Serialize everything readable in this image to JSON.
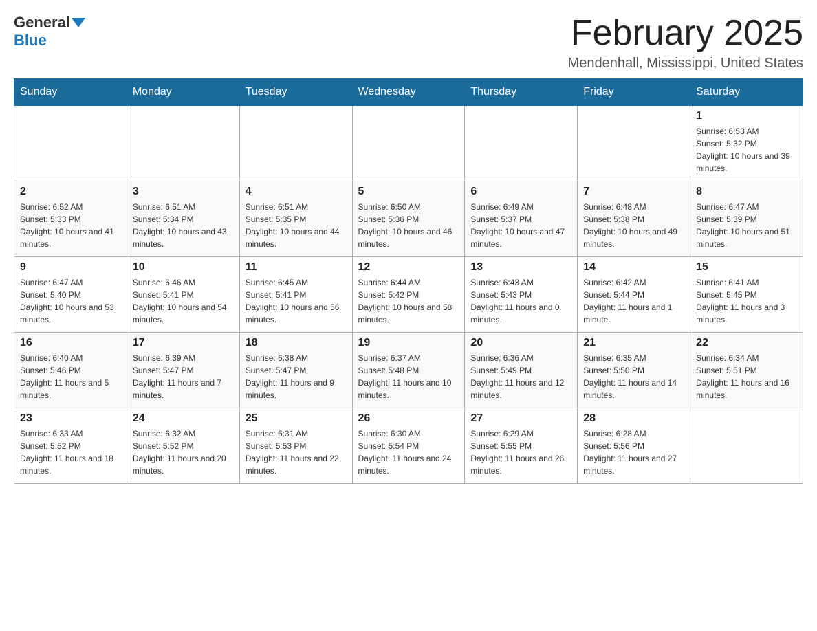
{
  "logo": {
    "general": "General",
    "blue": "Blue"
  },
  "title": "February 2025",
  "location": "Mendenhall, Mississippi, United States",
  "weekdays": [
    "Sunday",
    "Monday",
    "Tuesday",
    "Wednesday",
    "Thursday",
    "Friday",
    "Saturday"
  ],
  "weeks": [
    [
      {
        "day": "",
        "sunrise": "",
        "sunset": "",
        "daylight": ""
      },
      {
        "day": "",
        "sunrise": "",
        "sunset": "",
        "daylight": ""
      },
      {
        "day": "",
        "sunrise": "",
        "sunset": "",
        "daylight": ""
      },
      {
        "day": "",
        "sunrise": "",
        "sunset": "",
        "daylight": ""
      },
      {
        "day": "",
        "sunrise": "",
        "sunset": "",
        "daylight": ""
      },
      {
        "day": "",
        "sunrise": "",
        "sunset": "",
        "daylight": ""
      },
      {
        "day": "1",
        "sunrise": "Sunrise: 6:53 AM",
        "sunset": "Sunset: 5:32 PM",
        "daylight": "Daylight: 10 hours and 39 minutes."
      }
    ],
    [
      {
        "day": "2",
        "sunrise": "Sunrise: 6:52 AM",
        "sunset": "Sunset: 5:33 PM",
        "daylight": "Daylight: 10 hours and 41 minutes."
      },
      {
        "day": "3",
        "sunrise": "Sunrise: 6:51 AM",
        "sunset": "Sunset: 5:34 PM",
        "daylight": "Daylight: 10 hours and 43 minutes."
      },
      {
        "day": "4",
        "sunrise": "Sunrise: 6:51 AM",
        "sunset": "Sunset: 5:35 PM",
        "daylight": "Daylight: 10 hours and 44 minutes."
      },
      {
        "day": "5",
        "sunrise": "Sunrise: 6:50 AM",
        "sunset": "Sunset: 5:36 PM",
        "daylight": "Daylight: 10 hours and 46 minutes."
      },
      {
        "day": "6",
        "sunrise": "Sunrise: 6:49 AM",
        "sunset": "Sunset: 5:37 PM",
        "daylight": "Daylight: 10 hours and 47 minutes."
      },
      {
        "day": "7",
        "sunrise": "Sunrise: 6:48 AM",
        "sunset": "Sunset: 5:38 PM",
        "daylight": "Daylight: 10 hours and 49 minutes."
      },
      {
        "day": "8",
        "sunrise": "Sunrise: 6:47 AM",
        "sunset": "Sunset: 5:39 PM",
        "daylight": "Daylight: 10 hours and 51 minutes."
      }
    ],
    [
      {
        "day": "9",
        "sunrise": "Sunrise: 6:47 AM",
        "sunset": "Sunset: 5:40 PM",
        "daylight": "Daylight: 10 hours and 53 minutes."
      },
      {
        "day": "10",
        "sunrise": "Sunrise: 6:46 AM",
        "sunset": "Sunset: 5:41 PM",
        "daylight": "Daylight: 10 hours and 54 minutes."
      },
      {
        "day": "11",
        "sunrise": "Sunrise: 6:45 AM",
        "sunset": "Sunset: 5:41 PM",
        "daylight": "Daylight: 10 hours and 56 minutes."
      },
      {
        "day": "12",
        "sunrise": "Sunrise: 6:44 AM",
        "sunset": "Sunset: 5:42 PM",
        "daylight": "Daylight: 10 hours and 58 minutes."
      },
      {
        "day": "13",
        "sunrise": "Sunrise: 6:43 AM",
        "sunset": "Sunset: 5:43 PM",
        "daylight": "Daylight: 11 hours and 0 minutes."
      },
      {
        "day": "14",
        "sunrise": "Sunrise: 6:42 AM",
        "sunset": "Sunset: 5:44 PM",
        "daylight": "Daylight: 11 hours and 1 minute."
      },
      {
        "day": "15",
        "sunrise": "Sunrise: 6:41 AM",
        "sunset": "Sunset: 5:45 PM",
        "daylight": "Daylight: 11 hours and 3 minutes."
      }
    ],
    [
      {
        "day": "16",
        "sunrise": "Sunrise: 6:40 AM",
        "sunset": "Sunset: 5:46 PM",
        "daylight": "Daylight: 11 hours and 5 minutes."
      },
      {
        "day": "17",
        "sunrise": "Sunrise: 6:39 AM",
        "sunset": "Sunset: 5:47 PM",
        "daylight": "Daylight: 11 hours and 7 minutes."
      },
      {
        "day": "18",
        "sunrise": "Sunrise: 6:38 AM",
        "sunset": "Sunset: 5:47 PM",
        "daylight": "Daylight: 11 hours and 9 minutes."
      },
      {
        "day": "19",
        "sunrise": "Sunrise: 6:37 AM",
        "sunset": "Sunset: 5:48 PM",
        "daylight": "Daylight: 11 hours and 10 minutes."
      },
      {
        "day": "20",
        "sunrise": "Sunrise: 6:36 AM",
        "sunset": "Sunset: 5:49 PM",
        "daylight": "Daylight: 11 hours and 12 minutes."
      },
      {
        "day": "21",
        "sunrise": "Sunrise: 6:35 AM",
        "sunset": "Sunset: 5:50 PM",
        "daylight": "Daylight: 11 hours and 14 minutes."
      },
      {
        "day": "22",
        "sunrise": "Sunrise: 6:34 AM",
        "sunset": "Sunset: 5:51 PM",
        "daylight": "Daylight: 11 hours and 16 minutes."
      }
    ],
    [
      {
        "day": "23",
        "sunrise": "Sunrise: 6:33 AM",
        "sunset": "Sunset: 5:52 PM",
        "daylight": "Daylight: 11 hours and 18 minutes."
      },
      {
        "day": "24",
        "sunrise": "Sunrise: 6:32 AM",
        "sunset": "Sunset: 5:52 PM",
        "daylight": "Daylight: 11 hours and 20 minutes."
      },
      {
        "day": "25",
        "sunrise": "Sunrise: 6:31 AM",
        "sunset": "Sunset: 5:53 PM",
        "daylight": "Daylight: 11 hours and 22 minutes."
      },
      {
        "day": "26",
        "sunrise": "Sunrise: 6:30 AM",
        "sunset": "Sunset: 5:54 PM",
        "daylight": "Daylight: 11 hours and 24 minutes."
      },
      {
        "day": "27",
        "sunrise": "Sunrise: 6:29 AM",
        "sunset": "Sunset: 5:55 PM",
        "daylight": "Daylight: 11 hours and 26 minutes."
      },
      {
        "day": "28",
        "sunrise": "Sunrise: 6:28 AM",
        "sunset": "Sunset: 5:56 PM",
        "daylight": "Daylight: 11 hours and 27 minutes."
      },
      {
        "day": "",
        "sunrise": "",
        "sunset": "",
        "daylight": ""
      }
    ]
  ]
}
